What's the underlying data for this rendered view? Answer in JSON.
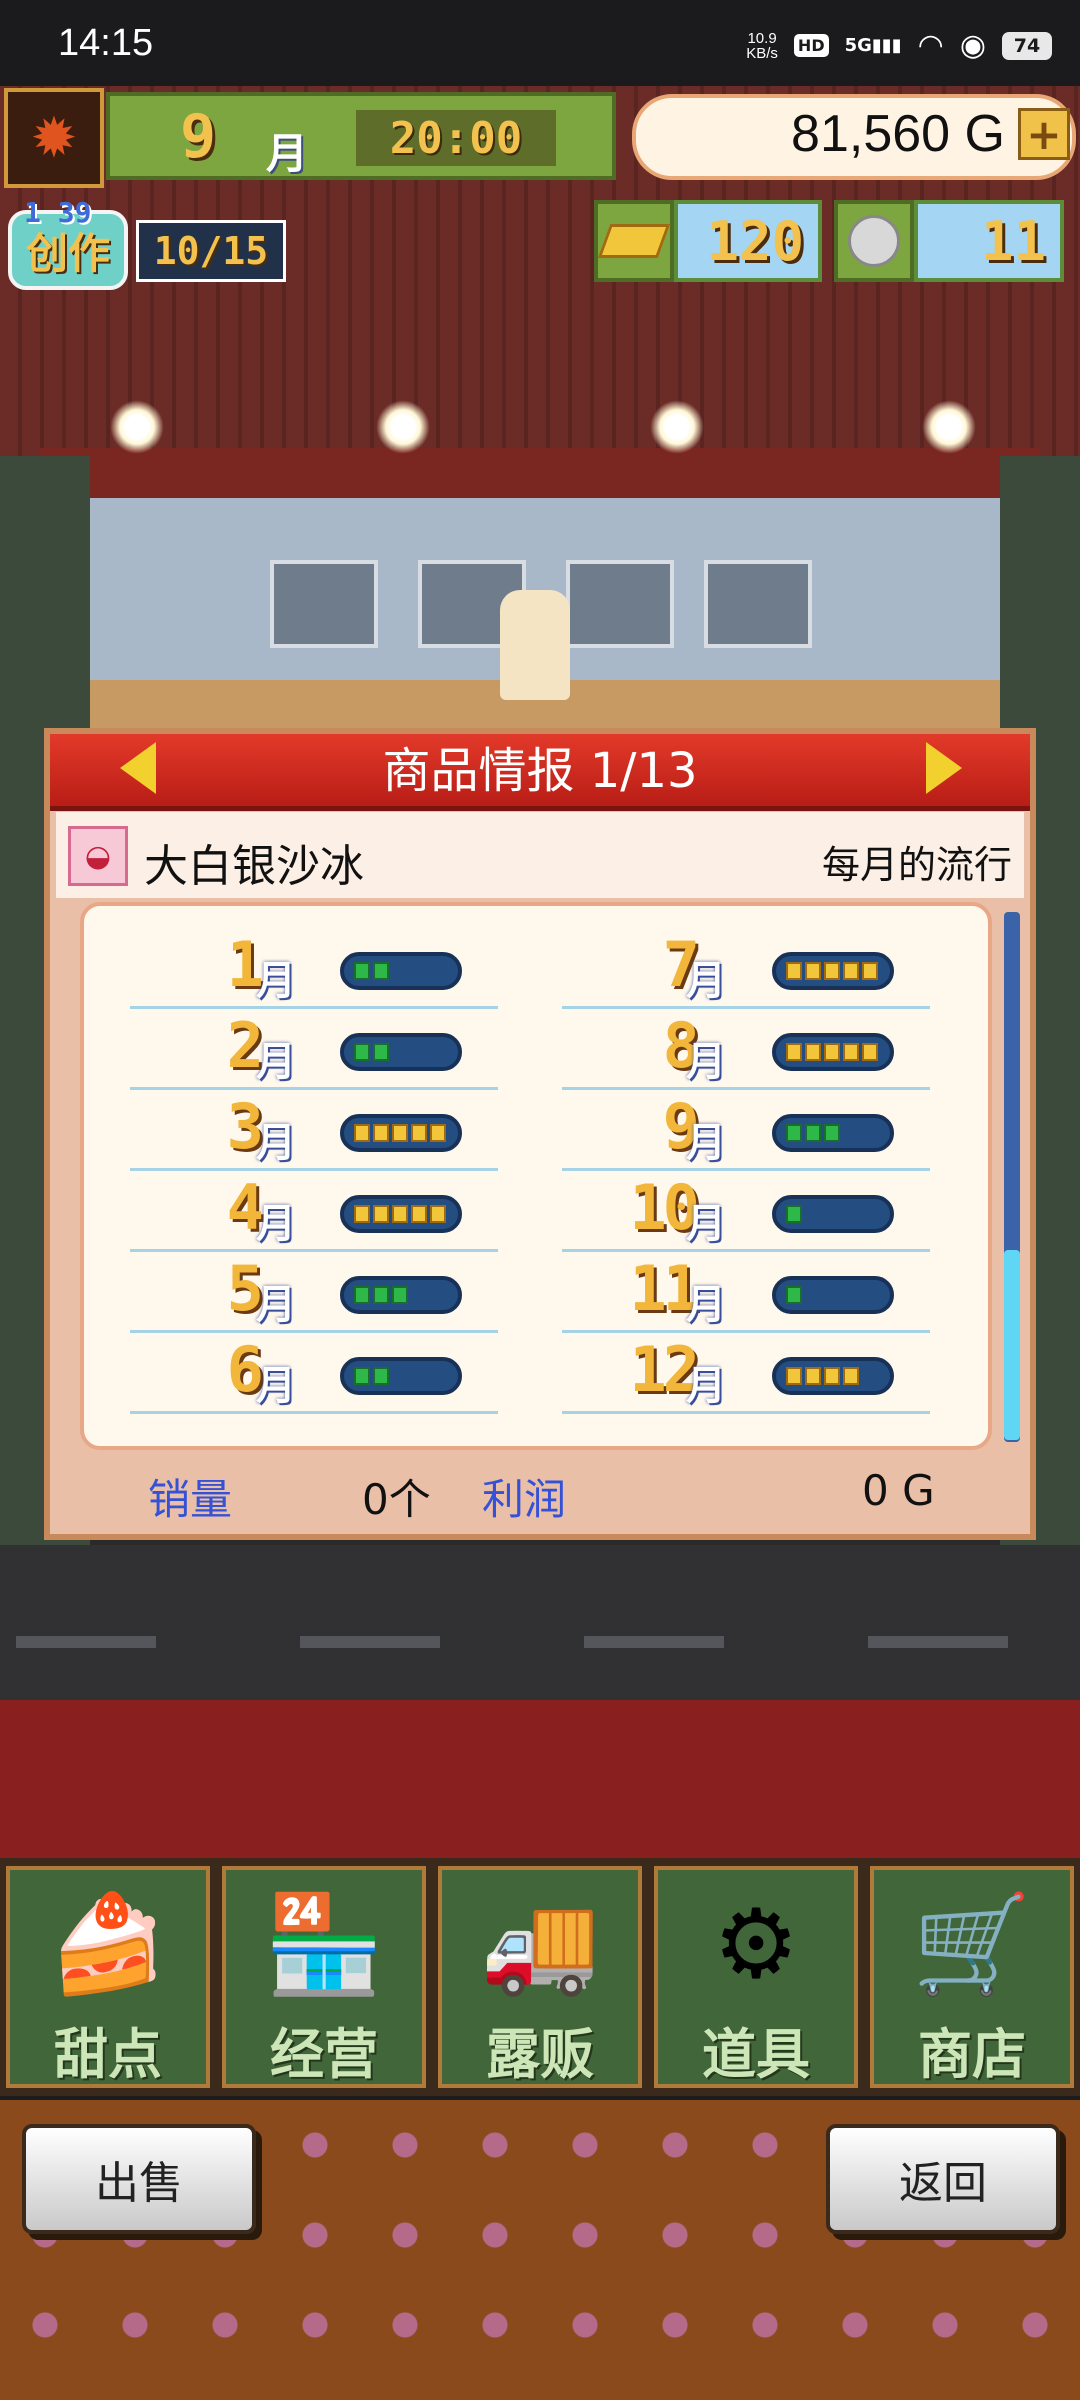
{
  "status_bar": {
    "time": "14:15",
    "speed": "10.9",
    "speed_unit": "KB/s",
    "hd": "HD",
    "network": "5G",
    "battery": "74"
  },
  "hud": {
    "month": "9",
    "month_label": "月",
    "clock": "20:00",
    "money": "81,560 G",
    "create_label": "创作",
    "create_timer": "1 39",
    "create_count": "10/15",
    "gold_bars": "120",
    "medals": "11"
  },
  "panel": {
    "title": "商品情报 1/13",
    "product_name": "大白银沙冰",
    "trend_label": "每月的流行",
    "months_left": [
      {
        "num": "1",
        "label": "月",
        "level": 2,
        "color": "green"
      },
      {
        "num": "2",
        "label": "月",
        "level": 2,
        "color": "green"
      },
      {
        "num": "3",
        "label": "月",
        "level": 5,
        "color": "gold"
      },
      {
        "num": "4",
        "label": "月",
        "level": 5,
        "color": "gold"
      },
      {
        "num": "5",
        "label": "月",
        "level": 3,
        "color": "green"
      },
      {
        "num": "6",
        "label": "月",
        "level": 2,
        "color": "green"
      }
    ],
    "months_right": [
      {
        "num": "7",
        "label": "月",
        "level": 5,
        "color": "gold"
      },
      {
        "num": "8",
        "label": "月",
        "level": 5,
        "color": "gold"
      },
      {
        "num": "9",
        "label": "月",
        "level": 3,
        "color": "green"
      },
      {
        "num": "10",
        "label": "月",
        "level": 1,
        "color": "green"
      },
      {
        "num": "11",
        "label": "月",
        "level": 1,
        "color": "green"
      },
      {
        "num": "12",
        "label": "月",
        "level": 4,
        "color": "gold"
      }
    ],
    "sales_label": "销量",
    "sales_value": "0个",
    "profit_label": "利润",
    "profit_value": "0 G"
  },
  "nav": {
    "items": [
      {
        "label": "甜点",
        "icon": "cake-icon"
      },
      {
        "label": "经营",
        "icon": "shop-building-icon"
      },
      {
        "label": "露贩",
        "icon": "food-truck-icon"
      },
      {
        "label": "道具",
        "icon": "gear-bag-icon"
      },
      {
        "label": "商店",
        "icon": "cart-icon"
      }
    ]
  },
  "buttons": {
    "sell": "出售",
    "back": "返回"
  },
  "colors": {
    "accent_red": "#c8241b",
    "gauge_green": "#2fb84a",
    "gauge_gold": "#f2c63a",
    "stat_blue": "#3551d6"
  }
}
